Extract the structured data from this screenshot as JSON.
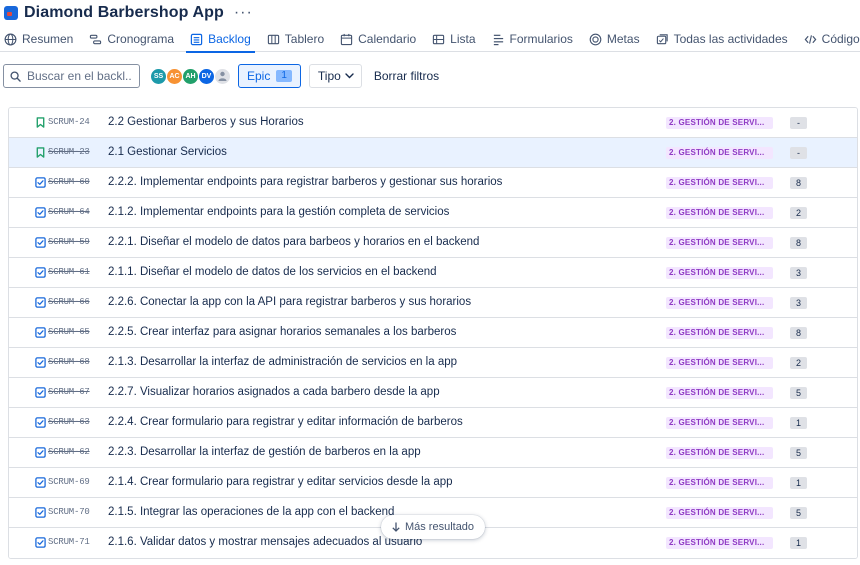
{
  "app": {
    "title": "Diamond Barbershop App",
    "more_icon": "more-horizontal-icon"
  },
  "tabs": [
    {
      "label": "Resumen",
      "icon": "globe-icon"
    },
    {
      "label": "Cronograma",
      "icon": "timeline-icon"
    },
    {
      "label": "Backlog",
      "icon": "backlog-icon",
      "active": true
    },
    {
      "label": "Tablero",
      "icon": "board-icon"
    },
    {
      "label": "Calendario",
      "icon": "calendar-icon"
    },
    {
      "label": "Lista",
      "icon": "list-icon"
    },
    {
      "label": "Formularios",
      "icon": "forms-icon"
    },
    {
      "label": "Metas",
      "icon": "target-icon"
    },
    {
      "label": "Todas las actividades",
      "icon": "activity-icon"
    },
    {
      "label": "Código",
      "icon": "code-icon"
    }
  ],
  "toolbar": {
    "search_placeholder": "Buscar en el backl...",
    "avatars": [
      {
        "initials": "SS",
        "color": "#1d9aaa"
      },
      {
        "initials": "AC",
        "color": "#f79233"
      },
      {
        "initials": "AH",
        "color": "#22a06b"
      },
      {
        "initials": "DV",
        "color": "#0c66e4"
      },
      {
        "initials": "",
        "color": "#dfe1e6"
      }
    ],
    "epic_label": "Epic",
    "epic_count": "1",
    "type_label": "Tipo",
    "clear_label": "Borrar filtros"
  },
  "colors": {
    "accent": "#0c66e4",
    "epic_bg": "#f3e6ff",
    "epic_text": "#8f3ac4",
    "selected_row": "#e9f2ff"
  },
  "issues": [
    {
      "type": "story",
      "key": "SCRUM-24",
      "done": false,
      "summary": "2.2 Gestionar Barberos y sus Horarios",
      "epic": "2. GESTIÓN DE SERVI...",
      "points": "-"
    },
    {
      "type": "story",
      "key": "SCRUM-23",
      "done": true,
      "summary": "2.1 Gestionar Servicios",
      "epic": "2. GESTIÓN DE SERVI...",
      "points": "-",
      "selected": true
    },
    {
      "type": "task",
      "key": "SCRUM-60",
      "done": true,
      "summary": "2.2.2. Implementar endpoints para registrar barberos y gestionar sus horarios",
      "epic": "2. GESTIÓN DE SERVI...",
      "points": "8"
    },
    {
      "type": "task",
      "key": "SCRUM-64",
      "done": true,
      "summary": "2.1.2. Implementar endpoints para la gestión completa de servicios",
      "epic": "2. GESTIÓN DE SERVI...",
      "points": "2"
    },
    {
      "type": "task",
      "key": "SCRUM-59",
      "done": true,
      "summary": "2.2.1. Diseñar el modelo de datos para barbeos y horarios en el backend",
      "epic": "2. GESTIÓN DE SERVI...",
      "points": "8"
    },
    {
      "type": "task",
      "key": "SCRUM-61",
      "done": true,
      "summary": "2.1.1. Diseñar el modelo de datos de los servicios en el backend",
      "epic": "2. GESTIÓN DE SERVI...",
      "points": "3"
    },
    {
      "type": "task",
      "key": "SCRUM-66",
      "done": true,
      "summary": "2.2.6. Conectar la app con la API para registrar barberos y sus horarios",
      "epic": "2. GESTIÓN DE SERVI...",
      "points": "3"
    },
    {
      "type": "task",
      "key": "SCRUM-65",
      "done": true,
      "summary": "2.2.5. Crear interfaz para asignar horarios semanales a los barberos",
      "epic": "2. GESTIÓN DE SERVI...",
      "points": "8"
    },
    {
      "type": "task",
      "key": "SCRUM-68",
      "done": true,
      "summary": "2.1.3. Desarrollar la interfaz de administración de servicios en la app",
      "epic": "2. GESTIÓN DE SERVI...",
      "points": "2"
    },
    {
      "type": "task",
      "key": "SCRUM-67",
      "done": true,
      "summary": "2.2.7. Visualizar horarios asignados a cada barbero desde la app",
      "epic": "2. GESTIÓN DE SERVI...",
      "points": "5"
    },
    {
      "type": "task",
      "key": "SCRUM-63",
      "done": true,
      "summary": "2.2.4. Crear formulario para registrar y editar información de barberos",
      "epic": "2. GESTIÓN DE SERVI...",
      "points": "1"
    },
    {
      "type": "task",
      "key": "SCRUM-62",
      "done": true,
      "summary": "2.2.3. Desarrollar la interfaz de gestión de barberos en la app",
      "epic": "2. GESTIÓN DE SERVI...",
      "points": "5"
    },
    {
      "type": "task",
      "key": "SCRUM-69",
      "done": false,
      "summary": "2.1.4. Crear formulario para registrar y editar servicios desde la app",
      "epic": "2. GESTIÓN DE SERVI...",
      "points": "1"
    },
    {
      "type": "task",
      "key": "SCRUM-70",
      "done": false,
      "summary": "2.1.5. Integrar las operaciones de la app con el backend",
      "epic": "2. GESTIÓN DE SERVI...",
      "points": "5"
    },
    {
      "type": "task",
      "key": "SCRUM-71",
      "done": false,
      "summary": "2.1.6. Validar datos y mostrar mensajes adecuados al usuario",
      "epic": "2. GESTIÓN DE SERVI...",
      "points": "1"
    }
  ],
  "more_results_label": "Más resultado"
}
